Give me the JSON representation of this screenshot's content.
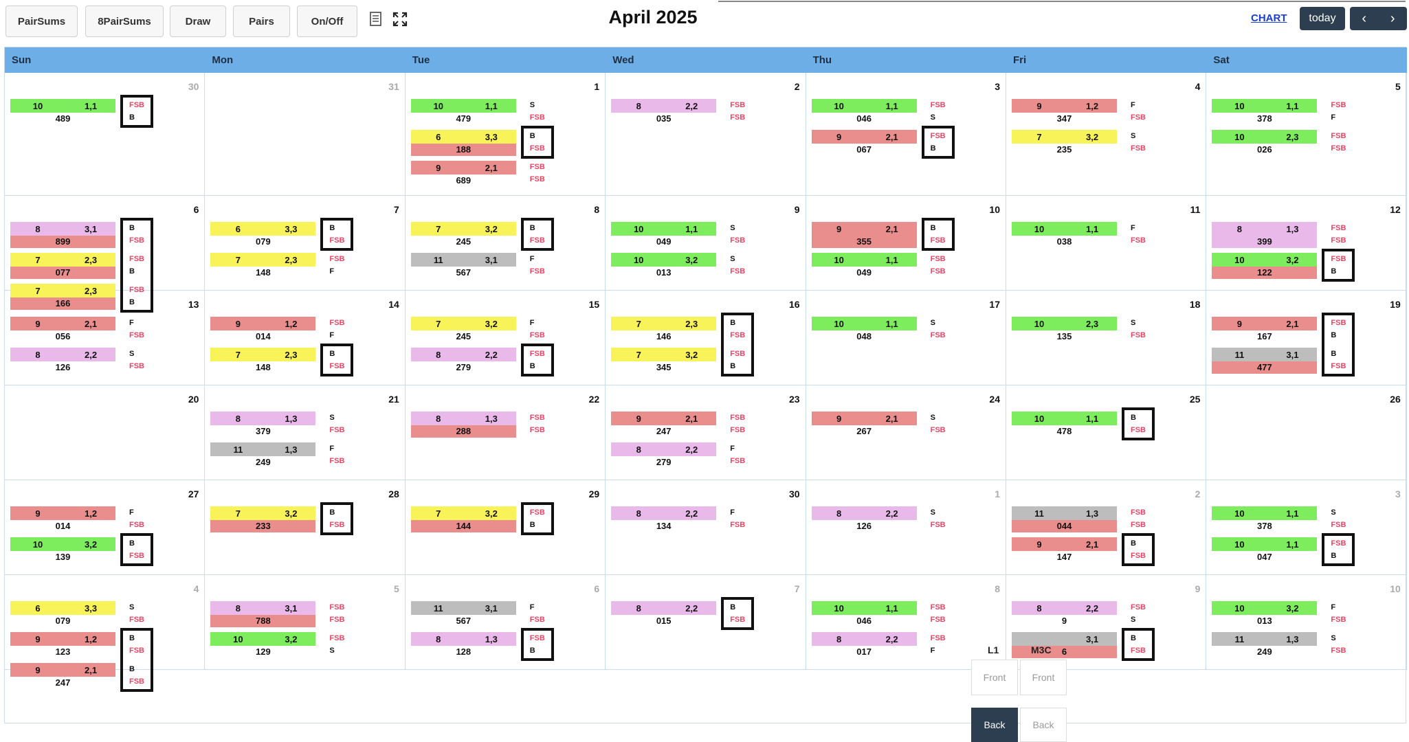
{
  "toolbar": {
    "buttons": [
      "PairSums",
      "8PairSums",
      "Draw",
      "Pairs",
      "On/Off"
    ],
    "icons": [
      "notes-icon",
      "fullscreen-icon"
    ],
    "title": "April 2025",
    "chart_link": "CHART",
    "today": "today",
    "prev": "‹",
    "next": "›"
  },
  "days": [
    "Sun",
    "Mon",
    "Tue",
    "Wed",
    "Thu",
    "Fri",
    "Sat"
  ],
  "weeks": [
    [
      {
        "d": "30",
        "dim": true,
        "e": [
          {
            "c": "g",
            "a": "10",
            "b": "1,1",
            "s": "489",
            "t": "FSB",
            "boxed": true
          },
          {
            "t": "B",
            "boxed": true
          }
        ]
      },
      {
        "d": "31",
        "dim": true,
        "e": []
      },
      {
        "d": "1",
        "e": [
          {
            "c": "g",
            "a": "10",
            "b": "1,1",
            "s": "479",
            "t": "S"
          },
          {
            "t": "FSB"
          },
          {
            "c": "y",
            "a": "6",
            "b": "3,3",
            "sc": "r",
            "s": "188",
            "t": "B",
            "boxed": true
          },
          {
            "t": "FSB",
            "boxed": true
          },
          {
            "c": "r",
            "a": "9",
            "b": "2,1",
            "s": "689",
            "t": "FSB"
          },
          {
            "t": "FSB"
          }
        ]
      },
      {
        "d": "2",
        "e": [
          {
            "c": "p",
            "a": "8",
            "b": "2,2",
            "s": "035",
            "t": "FSB"
          },
          {
            "t": "FSB"
          }
        ]
      },
      {
        "d": "3",
        "e": [
          {
            "c": "g",
            "a": "10",
            "b": "1,1",
            "s": "046",
            "t": "FSB"
          },
          {
            "t": "S"
          },
          {
            "c": "r",
            "a": "9",
            "b": "2,1",
            "s": "067",
            "t": "FSB",
            "boxed": true
          },
          {
            "t": "B",
            "boxed": true
          }
        ]
      },
      {
        "d": "4",
        "e": [
          {
            "c": "r",
            "a": "9",
            "b": "1,2",
            "s": "347",
            "t": "F"
          },
          {
            "t": "FSB"
          },
          {
            "c": "y",
            "a": "7",
            "b": "3,2",
            "s": "235",
            "t": "S"
          },
          {
            "t": "FSB"
          }
        ]
      },
      {
        "d": "5",
        "e": [
          {
            "c": "g",
            "a": "10",
            "b": "1,1",
            "s": "378",
            "t": "FSB"
          },
          {
            "t": "F"
          },
          {
            "c": "g",
            "a": "10",
            "b": "2,3",
            "s": "026",
            "t": "FSB"
          },
          {
            "t": "FSB"
          }
        ]
      }
    ],
    [
      {
        "d": "6",
        "e": [
          {
            "c": "p",
            "a": "8",
            "b": "3,1",
            "sc": "r",
            "s": "899",
            "t": "B",
            "boxed": true
          },
          {
            "t": "FSB",
            "boxed": true
          },
          {
            "c": "y",
            "a": "7",
            "b": "2,3",
            "sc": "r",
            "s": "077",
            "t": "FSB",
            "boxed": true
          },
          {
            "t": "B",
            "boxed": true
          },
          {
            "c": "y",
            "a": "7",
            "b": "2,3",
            "sc": "r",
            "s": "166",
            "t": "FSB",
            "boxed": true
          },
          {
            "t": "B",
            "boxed": true
          }
        ]
      },
      {
        "d": "7",
        "e": [
          {
            "c": "y",
            "a": "6",
            "b": "3,3",
            "s": "079",
            "t": "B",
            "boxed": true
          },
          {
            "t": "FSB",
            "boxed": true
          },
          {
            "c": "y",
            "a": "7",
            "b": "2,3",
            "s": "148",
            "t": "FSB"
          },
          {
            "t": "F"
          }
        ]
      },
      {
        "d": "8",
        "e": [
          {
            "c": "y",
            "a": "7",
            "b": "3,2",
            "s": "245",
            "t": "B",
            "boxed": true
          },
          {
            "t": "FSB",
            "boxed": true
          },
          {
            "c": "gr",
            "a": "11",
            "b": "3,1",
            "s": "567",
            "t": "F"
          },
          {
            "t": "FSB"
          }
        ]
      },
      {
        "d": "9",
        "e": [
          {
            "c": "g",
            "a": "10",
            "b": "1,1",
            "s": "049",
            "t": "S"
          },
          {
            "t": "FSB"
          },
          {
            "c": "g",
            "a": "10",
            "b": "3,2",
            "s": "013",
            "t": "S"
          },
          {
            "t": "FSB"
          }
        ]
      },
      {
        "d": "10",
        "e": [
          {
            "c": "r",
            "a": "9",
            "b": "2,1",
            "sc": "r",
            "s": "355",
            "t": "B",
            "boxed": true
          },
          {
            "t": "FSB",
            "boxed": true
          },
          {
            "c": "g",
            "a": "10",
            "b": "1,1",
            "s": "049",
            "t": "FSB"
          },
          {
            "t": "FSB"
          }
        ]
      },
      {
        "d": "11",
        "e": [
          {
            "c": "g",
            "a": "10",
            "b": "1,1",
            "s": "038",
            "t": "F"
          },
          {
            "t": "FSB"
          }
        ]
      },
      {
        "d": "12",
        "e": [
          {
            "c": "p",
            "a": "8",
            "b": "1,3",
            "sc": "p",
            "s": "399",
            "t": "FSB"
          },
          {
            "t": "FSB"
          },
          {
            "c": "g",
            "a": "10",
            "b": "3,2",
            "sc": "r",
            "s": "122",
            "t": "FSB",
            "boxed": true
          },
          {
            "t": "B",
            "boxed": true
          }
        ]
      }
    ],
    [
      {
        "d": "13",
        "e": [
          {
            "c": "r",
            "a": "9",
            "b": "2,1",
            "s": "056",
            "t": "F"
          },
          {
            "t": "FSB"
          },
          {
            "c": "p",
            "a": "8",
            "b": "2,2",
            "s": "126",
            "t": "S"
          },
          {
            "t": "FSB"
          }
        ]
      },
      {
        "d": "14",
        "e": [
          {
            "c": "r",
            "a": "9",
            "b": "1,2",
            "s": "014",
            "t": "FSB"
          },
          {
            "t": "F"
          },
          {
            "c": "y",
            "a": "7",
            "b": "2,3",
            "s": "148",
            "t": "B",
            "boxed": true
          },
          {
            "t": "FSB",
            "boxed": true
          }
        ]
      },
      {
        "d": "15",
        "e": [
          {
            "c": "y",
            "a": "7",
            "b": "3,2",
            "s": "245",
            "t": "F"
          },
          {
            "t": "FSB"
          },
          {
            "c": "p",
            "a": "8",
            "b": "2,2",
            "s": "279",
            "t": "FSB",
            "boxed": true
          },
          {
            "t": "B",
            "boxed": true
          }
        ]
      },
      {
        "d": "16",
        "e": [
          {
            "c": "y",
            "a": "7",
            "b": "2,3",
            "s": "146",
            "t": "B",
            "boxed": true
          },
          {
            "t": "FSB",
            "boxed": true
          },
          {
            "c": "y",
            "a": "7",
            "b": "3,2",
            "s": "345",
            "t": "FSB",
            "boxed": true
          },
          {
            "t": "B",
            "boxed": true
          }
        ]
      },
      {
        "d": "17",
        "e": [
          {
            "c": "g",
            "a": "10",
            "b": "1,1",
            "s": "048",
            "t": "S"
          },
          {
            "t": "FSB"
          }
        ]
      },
      {
        "d": "18",
        "e": [
          {
            "c": "g",
            "a": "10",
            "b": "2,3",
            "s": "135",
            "t": "S"
          },
          {
            "t": "FSB"
          }
        ]
      },
      {
        "d": "19",
        "e": [
          {
            "c": "r",
            "a": "9",
            "b": "2,1",
            "s": "167",
            "t": "FSB",
            "boxed": true
          },
          {
            "t": "B",
            "boxed": true
          },
          {
            "c": "gr",
            "a": "11",
            "b": "3,1",
            "sc": "r",
            "s": "477",
            "t": "B",
            "boxed": true
          },
          {
            "t": "FSB",
            "boxed": true
          }
        ]
      }
    ],
    [
      {
        "d": "20",
        "e": []
      },
      {
        "d": "21",
        "e": [
          {
            "c": "p",
            "a": "8",
            "b": "1,3",
            "s": "379",
            "t": "S"
          },
          {
            "t": "FSB"
          },
          {
            "c": "gr",
            "a": "11",
            "b": "1,3",
            "s": "249",
            "t": "F"
          },
          {
            "t": "FSB"
          }
        ]
      },
      {
        "d": "22",
        "e": [
          {
            "c": "p",
            "a": "8",
            "b": "1,3",
            "sc": "r",
            "s": "288",
            "t": "FSB"
          },
          {
            "t": "FSB"
          }
        ]
      },
      {
        "d": "23",
        "e": [
          {
            "c": "r",
            "a": "9",
            "b": "2,1",
            "s": "247",
            "t": "FSB"
          },
          {
            "t": "FSB"
          },
          {
            "c": "p",
            "a": "8",
            "b": "2,2",
            "s": "279",
            "t": "F"
          },
          {
            "t": "FSB"
          }
        ]
      },
      {
        "d": "24",
        "e": [
          {
            "c": "r",
            "a": "9",
            "b": "2,1",
            "s": "267",
            "t": "S"
          },
          {
            "t": "FSB"
          }
        ]
      },
      {
        "d": "25",
        "e": [
          {
            "c": "g",
            "a": "10",
            "b": "1,1",
            "s": "478",
            "t": "B",
            "boxed": true
          },
          {
            "t": "FSB",
            "boxed": true
          }
        ]
      },
      {
        "d": "26",
        "e": []
      }
    ],
    [
      {
        "d": "27",
        "e": [
          {
            "c": "r",
            "a": "9",
            "b": "1,2",
            "s": "014",
            "t": "F"
          },
          {
            "t": "FSB"
          },
          {
            "c": "g",
            "a": "10",
            "b": "3,2",
            "s": "139",
            "t": "B",
            "boxed": true
          },
          {
            "t": "FSB",
            "boxed": true
          }
        ]
      },
      {
        "d": "28",
        "e": [
          {
            "c": "y",
            "a": "7",
            "b": "3,2",
            "sc": "r",
            "s": "233",
            "t": "B",
            "boxed": true
          },
          {
            "t": "FSB",
            "boxed": true
          }
        ]
      },
      {
        "d": "29",
        "e": [
          {
            "c": "y",
            "a": "7",
            "b": "3,2",
            "sc": "r",
            "s": "144",
            "t": "FSB",
            "boxed": true
          },
          {
            "t": "B",
            "boxed": true
          }
        ]
      },
      {
        "d": "30",
        "e": [
          {
            "c": "p",
            "a": "8",
            "b": "2,2",
            "s": "134",
            "t": "F"
          },
          {
            "t": "FSB"
          }
        ]
      },
      {
        "d": "1",
        "dim": true,
        "e": [
          {
            "c": "p",
            "a": "8",
            "b": "2,2",
            "s": "126",
            "t": "S"
          },
          {
            "t": "FSB"
          }
        ]
      },
      {
        "d": "2",
        "dim": true,
        "e": [
          {
            "c": "gr",
            "a": "11",
            "b": "1,3",
            "sc": "r",
            "s": "044",
            "t": "FSB"
          },
          {
            "t": "FSB"
          },
          {
            "c": "r",
            "a": "9",
            "b": "2,1",
            "s": "147",
            "t": "B",
            "boxed": true
          },
          {
            "t": "FSB",
            "boxed": true
          }
        ]
      },
      {
        "d": "3",
        "dim": true,
        "e": [
          {
            "c": "g",
            "a": "10",
            "b": "1,1",
            "s": "378",
            "t": "S"
          },
          {
            "t": "FSB"
          },
          {
            "c": "g",
            "a": "10",
            "b": "1,1",
            "s": "047",
            "t": "FSB",
            "boxed": true
          },
          {
            "t": "B",
            "boxed": true
          }
        ]
      }
    ],
    [
      {
        "d": "4",
        "dim": true,
        "e": [
          {
            "c": "y",
            "a": "6",
            "b": "3,3",
            "s": "079",
            "t": "S"
          },
          {
            "t": "FSB"
          },
          {
            "c": "r",
            "a": "9",
            "b": "1,2",
            "s": "123",
            "t": "B",
            "boxed": true
          },
          {
            "t": "FSB",
            "boxed": true
          },
          {
            "c": "r",
            "a": "9",
            "b": "2,1",
            "s": "247",
            "t": "B",
            "boxed": true
          },
          {
            "t": "FSB",
            "boxed": true
          }
        ]
      },
      {
        "d": "5",
        "dim": true,
        "e": [
          {
            "c": "p",
            "a": "8",
            "b": "3,1",
            "sc": "r",
            "s": "788",
            "t": "FSB"
          },
          {
            "t": "FSB"
          },
          {
            "c": "g",
            "a": "10",
            "b": "3,2",
            "s": "129",
            "t": "FSB"
          },
          {
            "t": "S"
          }
        ]
      },
      {
        "d": "6",
        "dim": true,
        "e": [
          {
            "c": "gr",
            "a": "11",
            "b": "3,1",
            "s": "567",
            "t": "F"
          },
          {
            "t": "FSB"
          },
          {
            "c": "p",
            "a": "8",
            "b": "1,3",
            "s": "128",
            "t": "FSB",
            "boxed": true
          },
          {
            "t": "B",
            "boxed": true
          }
        ]
      },
      {
        "d": "7",
        "dim": true,
        "e": [
          {
            "c": "p",
            "a": "8",
            "b": "2,2",
            "s": "015",
            "t": "B",
            "boxed": true
          },
          {
            "t": "FSB",
            "boxed": true
          }
        ]
      },
      {
        "d": "8",
        "dim": true,
        "e": [
          {
            "c": "g",
            "a": "10",
            "b": "1,1",
            "s": "046",
            "t": "FSB"
          },
          {
            "t": "FSB"
          },
          {
            "c": "p",
            "a": "8",
            "b": "2,2",
            "s": "017",
            "t": "FSB"
          },
          {
            "t": "F"
          }
        ]
      },
      {
        "d": "9",
        "dim": true,
        "e": [
          {
            "c": "p",
            "a": "8",
            "b": "2,2",
            "s": "9",
            "t": "FSB"
          },
          {
            "t": "S"
          },
          {
            "c": "gr",
            "a": "",
            "b": "3,1",
            "sc": "r",
            "s": "6",
            "t": "B",
            "boxed": true
          },
          {
            "t": "FSB",
            "boxed": true
          }
        ]
      },
      {
        "d": "10",
        "dim": true,
        "e": [
          {
            "c": "g",
            "a": "10",
            "b": "3,2",
            "s": "013",
            "t": "F"
          },
          {
            "t": "FSB"
          },
          {
            "c": "gr",
            "a": "11",
            "b": "1,3",
            "s": "249",
            "t": "S"
          },
          {
            "t": "FSB"
          }
        ]
      }
    ]
  ],
  "overlay": {
    "l1": "L1",
    "m3c": "M3C",
    "front1": "Front",
    "front2": "Front",
    "back1": "Back",
    "back2": "Back"
  }
}
